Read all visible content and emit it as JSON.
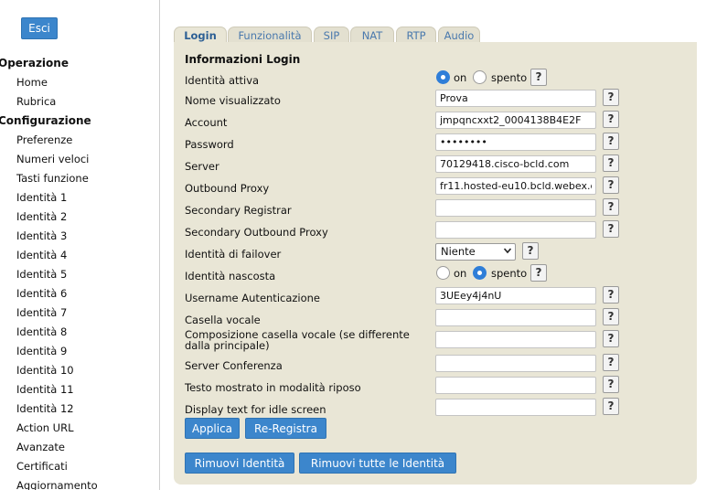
{
  "sidebar": {
    "logout_label": "Esci",
    "sections": [
      {
        "title": "Operazione",
        "items": [
          "Home",
          "Rubrica"
        ]
      },
      {
        "title": "Configurazione",
        "items": [
          "Preferenze",
          "Numeri veloci",
          "Tasti funzione",
          "Identità 1",
          "Identità 2",
          "Identità 3",
          "Identità 4",
          "Identità 5",
          "Identità 6",
          "Identità 7",
          "Identità 8",
          "Identità 9",
          "Identità 10",
          "Identità 11",
          "Identità 12",
          "Action URL",
          "Avanzate",
          "Certificati",
          "Aggiornamento"
        ]
      }
    ]
  },
  "tabs": [
    "Login",
    "Funzionalità",
    "SIP",
    "NAT",
    "RTP",
    "Audio"
  ],
  "active_tab": "Login",
  "form": {
    "section_title": "Informazioni Login",
    "help_glyph": "?",
    "identity_active": {
      "label": "Identità attiva",
      "on_label": "on",
      "off_label": "spento",
      "value": "on"
    },
    "display_name": {
      "label": "Nome visualizzato",
      "value": "Prova"
    },
    "account": {
      "label": "Account",
      "value": "jmpqncxxt2_0004138B4E2F"
    },
    "password": {
      "label": "Password",
      "value": "••••••••"
    },
    "server": {
      "label": "Server",
      "value": "70129418.cisco-bcld.com"
    },
    "outbound_proxy": {
      "label": "Outbound Proxy",
      "value": "fr11.hosted-eu10.bcld.webex.co"
    },
    "secondary_registrar": {
      "label": "Secondary Registrar",
      "value": ""
    },
    "secondary_outbound_proxy": {
      "label": "Secondary Outbound Proxy",
      "value": ""
    },
    "failover_identity": {
      "label": "Identità di failover",
      "value": "Niente"
    },
    "hidden_identity": {
      "label": "Identità nascosta",
      "on_label": "on",
      "off_label": "spento",
      "value": "spento"
    },
    "auth_username": {
      "label": "Username Autenticazione",
      "value": "3UEey4j4nU"
    },
    "voicemail": {
      "label": "Casella vocale",
      "value": ""
    },
    "voicemail_dial": {
      "label": "Composizione casella vocale (se differente dalla principale)",
      "value": ""
    },
    "conference_server": {
      "label": "Server Conferenza",
      "value": ""
    },
    "idle_text": {
      "label": "Testo mostrato in modalità riposo",
      "value": ""
    },
    "idle_text_en": {
      "label": "Display text for idle screen",
      "value": ""
    },
    "buttons": {
      "apply": "Applica",
      "reregister": "Re-Registra",
      "remove_identity": "Rimuovi Identità",
      "remove_all": "Rimuovi tutte le Identità"
    }
  },
  "colors": {
    "accent": "#3c86cc",
    "panel": "#e9e6d6",
    "tab": "#e3e0d0",
    "tab_text": "#4a79ad"
  }
}
